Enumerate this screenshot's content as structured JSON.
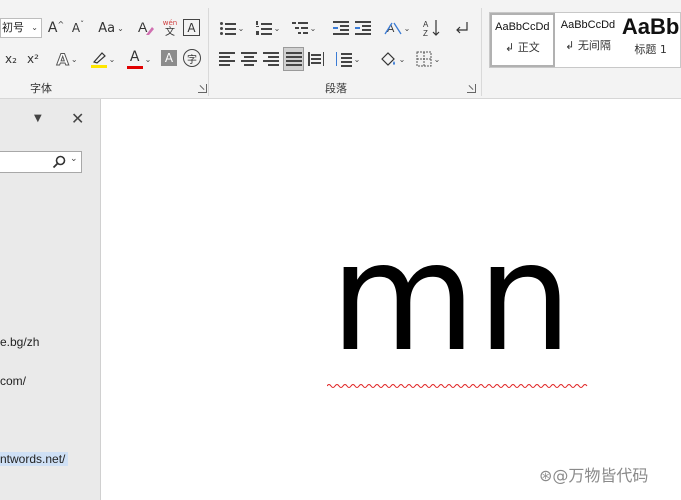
{
  "ribbon": {
    "font_group": {
      "label": "字体",
      "font_size": "初号",
      "grow_font": "A",
      "shrink_font": "A",
      "change_case": "Aa",
      "phonetic_top": "wén",
      "phonetic_bottom": "文",
      "char_border": "A",
      "subscript": "x₂",
      "superscript": "x²",
      "text_effects": "A",
      "highlight": "ab",
      "font_color": "A",
      "char_shading": "A",
      "enclose_char": "字"
    },
    "paragraph_group": {
      "label": "段落"
    },
    "styles": {
      "items": [
        {
          "sample": "AaBbCcDd",
          "name": "↲ 正文"
        },
        {
          "sample": "AaBbCcDd",
          "name": "↲ 无间隔"
        },
        {
          "sample": "AaBb",
          "name": "标题 1"
        }
      ]
    },
    "colors": {
      "highlight": "#ffe600",
      "font_color": "#e00000"
    }
  },
  "nav_pane": {
    "menu_icon": "chevron-down-icon",
    "close_icon": "close-icon",
    "search_icon": "search-icon",
    "links": [
      {
        "text": "e.bg/zh"
      },
      {
        "text": "com/"
      },
      {
        "text": "ntwords.net/"
      }
    ]
  },
  "document": {
    "text": "mn",
    "spelling_error_color": "#e02020"
  },
  "watermark": "⊛@万物皆代码"
}
